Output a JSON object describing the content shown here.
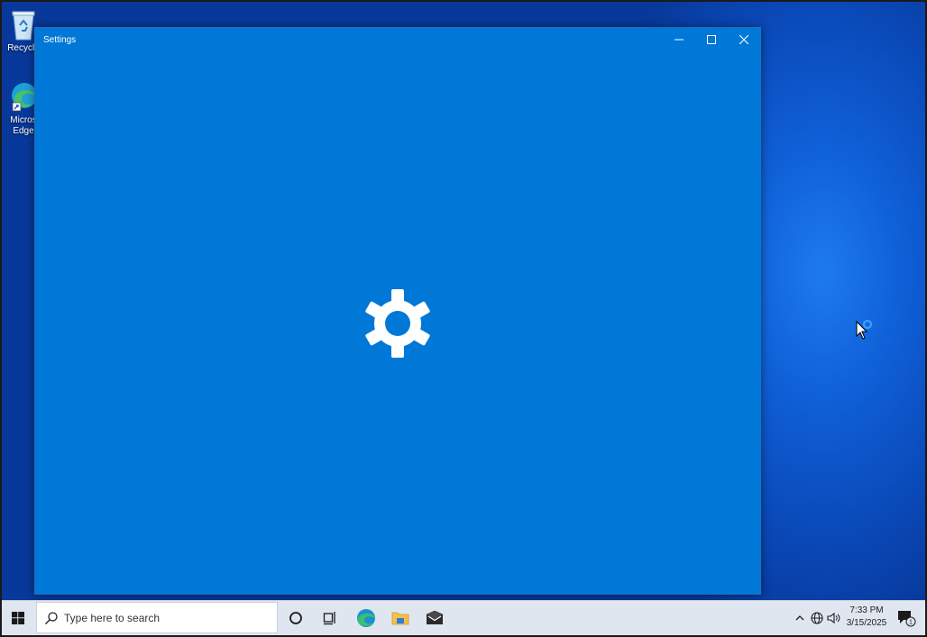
{
  "desktop": {
    "icons": [
      {
        "label": "Recycle",
        "icon": "recycle-bin-icon"
      },
      {
        "label": "Micros Edge",
        "icon": "edge-icon"
      }
    ]
  },
  "window": {
    "title": "Settings",
    "controls": [
      "minimize-icon",
      "maximize-icon",
      "close-icon"
    ],
    "background": "#0078d7"
  },
  "taskbar": {
    "search_placeholder": "Type here to search",
    "pinned": [
      "cortana-icon",
      "task-view-icon",
      "edge-icon",
      "file-explorer-icon",
      "mail-icon"
    ],
    "tray": [
      "chevron-up-icon",
      "network-globe-icon",
      "volume-icon"
    ],
    "time": "7:33 PM",
    "date": "3/15/2025",
    "notification_count": "1"
  },
  "colors": {
    "accent": "#0078d7",
    "desktop": "#0a49b8",
    "taskbar": "#dfe6ef"
  }
}
